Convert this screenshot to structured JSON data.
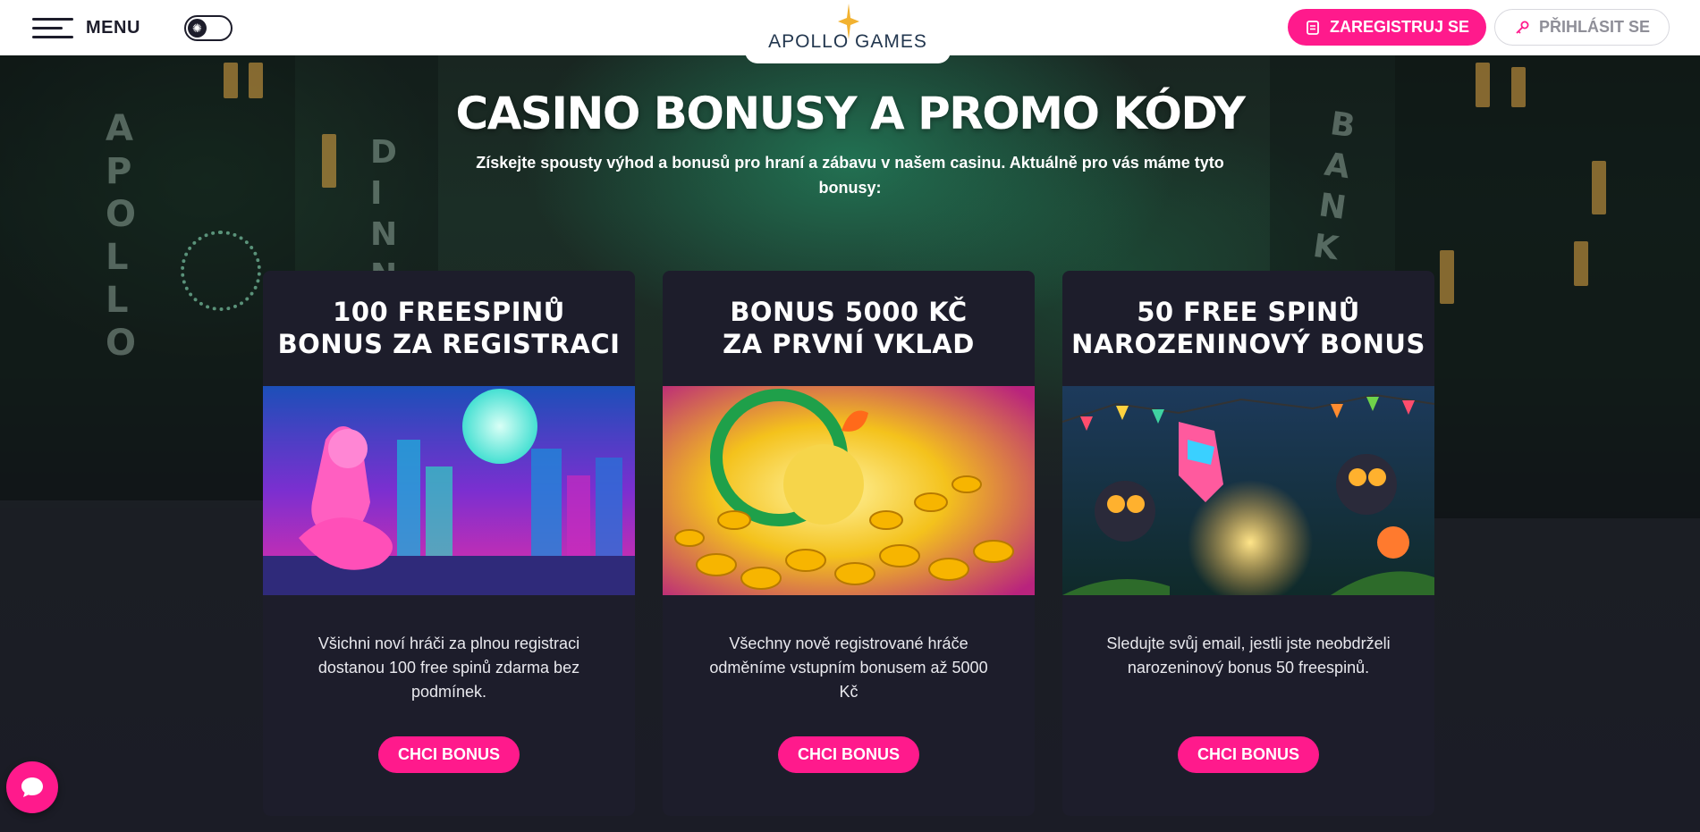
{
  "header": {
    "menu_label": "MENU",
    "logo_text": "APOLLO GAMES",
    "register_label": "ZAREGISTRUJ SE",
    "login_label": "PŘIHLÁSIT SE"
  },
  "hero": {
    "title": "CASINO BONUSY A PROMO KÓDY",
    "subtitle": "Získejte spousty výhod a bonusů pro hraní a zábavu v našem casinu. Aktuálně pro vás máme tyto bonusy:"
  },
  "background_signs": {
    "left": "APOLLO",
    "middle": "DINN",
    "right": "BANK"
  },
  "cards": [
    {
      "title": "100 FREESPINŮ\nBONUS ZA REGISTRACI",
      "description": "Všichni noví hráči za plnou registraci dostanou 100 free spinů zdarma bez podmínek.",
      "button_label": "CHCI BONUS"
    },
    {
      "title": "BONUS 5000 KČ\nZA PRVNÍ VKLAD",
      "description": "Všechny nově registrované hráče odměníme vstupním bonusem až 5000 Kč",
      "button_label": "CHCI BONUS"
    },
    {
      "title": "50 FREE SPINŮ\nNAROZENINOVÝ BONUS",
      "description": "Sledujte svůj email, jestli jste neobdrželi narozeninový bonus 50 freespinů.",
      "button_label": "CHCI BONUS"
    }
  ],
  "colors": {
    "accent": "#ff1a8c",
    "card_bg": "#1d1d2b",
    "header_bg": "#ffffff"
  },
  "icons": {
    "menu": "hamburger-icon",
    "theme": "sun-icon",
    "register": "form-icon",
    "login": "key-icon",
    "chat": "chat-bubble-icon"
  }
}
